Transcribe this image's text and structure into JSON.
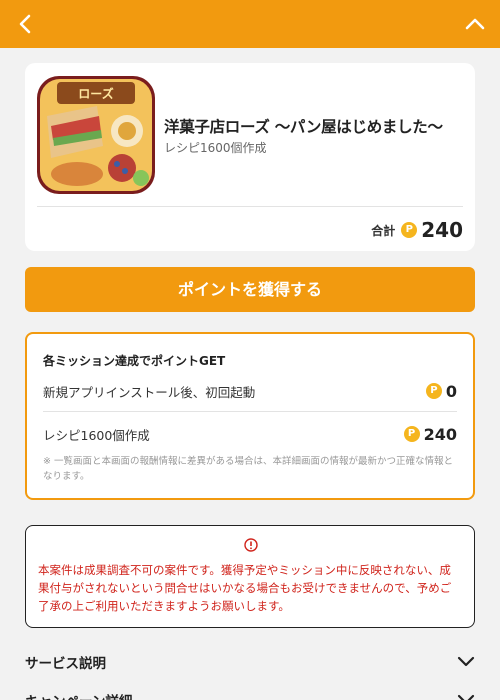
{
  "header": {
    "back_icon": "chevron-left-icon",
    "collapse_icon": "chevron-up-icon",
    "background": "#f29a0f"
  },
  "app": {
    "icon": "app-icon-bakery",
    "icon_text": "ローズ",
    "title": "洋菓子店ローズ 〜パン屋はじめました〜",
    "subtitle": "レシピ1600個作成",
    "total_label": "合計",
    "point_symbol": "P",
    "total_points": "240"
  },
  "cta": {
    "label": "ポイントを獲得する"
  },
  "missions": {
    "heading": "各ミッション達成でポイントGET",
    "items": [
      {
        "label": "新規アプリインストール後、初回起動",
        "points": "0"
      },
      {
        "label": "レシピ1600個作成",
        "points": "240"
      }
    ],
    "note": "※ 一覧画面と本画面の報酬情報に差異がある場合は、本詳細画面の情報が最新かつ正確な情報となります。"
  },
  "warning": {
    "icon": "info-icon",
    "text": "本案件は成果調査不可の案件です。獲得予定やミッション中に反映されない、成果付与がされないという問合せはいかなる場合もお受けできませんので、予めご了承の上ご利用いただきますようお願いします。",
    "color": "#d0241c"
  },
  "accordions": [
    {
      "title": "サービス説明"
    },
    {
      "title": "キャンペーン詳細"
    }
  ],
  "colors": {
    "accent": "#f29a0f",
    "coin": "#f5b51e"
  }
}
